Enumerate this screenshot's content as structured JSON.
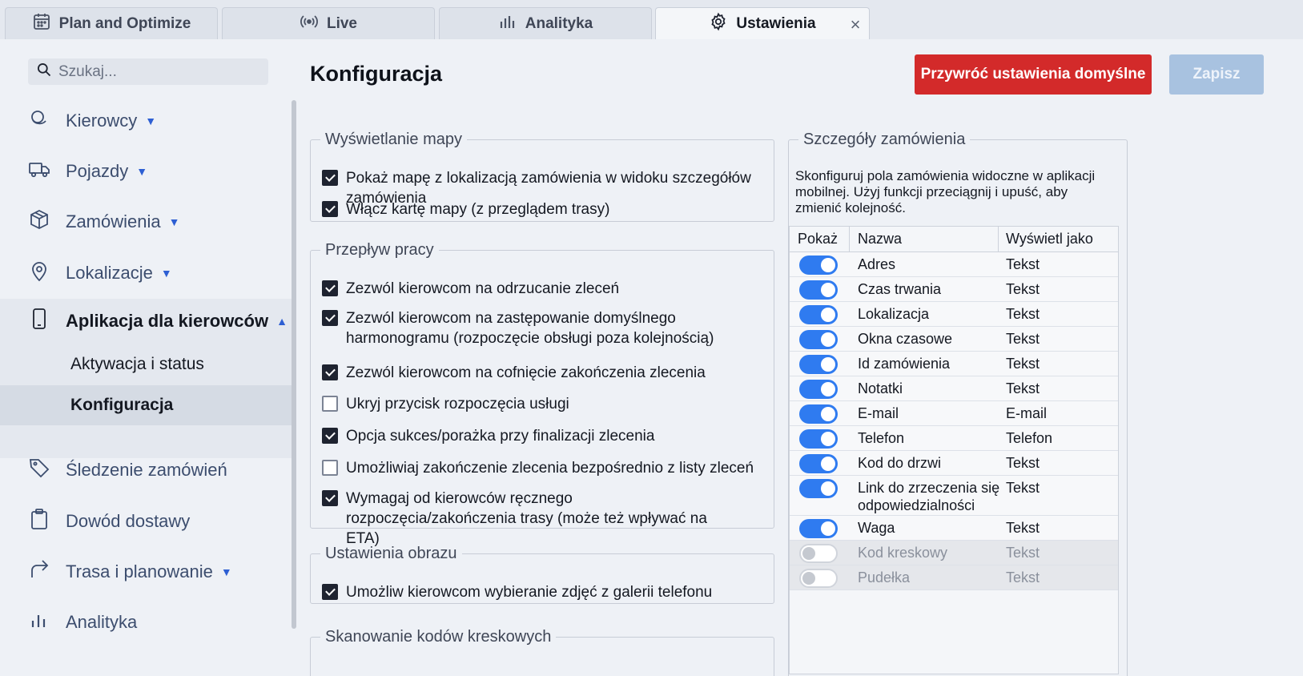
{
  "tabs": [
    {
      "label": "Plan and Optimize",
      "icon": "calendar-icon"
    },
    {
      "label": "Live",
      "icon": "broadcast-icon"
    },
    {
      "label": "Analityka",
      "icon": "bar-chart-icon"
    },
    {
      "label": "Ustawienia",
      "icon": "gear-icon",
      "active": true
    }
  ],
  "tab_close": "×",
  "search": {
    "placeholder": "Szukaj..."
  },
  "sidebar": {
    "items": [
      {
        "label": "Kierowcy",
        "icon": "drivers-icon",
        "caret": "▼"
      },
      {
        "label": "Pojazdy",
        "icon": "truck-icon",
        "caret": "▼"
      },
      {
        "label": "Zamówienia",
        "icon": "box-icon",
        "caret": "▼"
      },
      {
        "label": "Lokalizacje",
        "icon": "map-pin-icon",
        "caret": "▼"
      },
      {
        "label": "Aplikacja dla kierowców",
        "icon": "phone-icon",
        "caret": "▲"
      },
      {
        "label": "Śledzenie zamówień",
        "icon": "tag-icon"
      },
      {
        "label": "Dowód dostawy",
        "icon": "clipboard-icon"
      },
      {
        "label": "Trasa i planowanie",
        "icon": "route-arrow-icon",
        "caret": "▼"
      },
      {
        "label": "Analityka",
        "icon": "bar-chart-icon"
      }
    ],
    "sub_items": [
      {
        "label": "Aktywacja i status"
      },
      {
        "label": "Konfiguracja",
        "selected": true
      }
    ]
  },
  "main": {
    "title": "Konfiguracja",
    "reset_label": "Przywróć ustawienia domyślne",
    "save_label": "Zapisz"
  },
  "groups": {
    "map": {
      "legend": "Wyświetlanie mapy",
      "options": [
        {
          "label": "Pokaż mapę z lokalizacją zamówienia w widoku szczegółów zamówienia",
          "checked": true
        },
        {
          "label": "Włącz kartę mapy (z przeglądem trasy)",
          "checked": true
        }
      ]
    },
    "workflow": {
      "legend": "Przepływ pracy",
      "options": [
        {
          "label": "Zezwól kierowcom na odrzucanie zleceń",
          "checked": true
        },
        {
          "label": "Zezwól kierowcom na zastępowanie domyślnego harmonogramu (rozpoczęcie obsługi poza kolejnością)",
          "checked": true
        },
        {
          "label": "Zezwól kierowcom na cofnięcie zakończenia zlecenia",
          "checked": true
        },
        {
          "label": "Ukryj przycisk rozpoczęcia usługi",
          "checked": false
        },
        {
          "label": "Opcja sukces/porażka przy finalizacji zlecenia",
          "checked": true
        },
        {
          "label": "Umożliwiaj zakończenie zlecenia bezpośrednio z listy zleceń",
          "checked": false
        },
        {
          "label": "Wymagaj od kierowców ręcznego rozpoczęcia/zakończenia trasy (może też wpływać na ETA)",
          "checked": true
        }
      ]
    },
    "image": {
      "legend": "Ustawienia obrazu",
      "options": [
        {
          "label": "Umożliw kierowcom wybieranie zdjęć z galerii telefonu",
          "checked": true
        }
      ]
    },
    "barcode": {
      "legend": "Skanowanie kodów kreskowych"
    }
  },
  "order_details": {
    "legend": "Szczegóły zamówienia",
    "description": "Skonfiguruj pola zamówienia widoczne w aplikacji mobilnej. Użyj funkcji przeciągnij i upuść, aby zmienić kolejność.",
    "columns": [
      "Pokaż",
      "Nazwa",
      "Wyświetl jako"
    ],
    "rows": [
      {
        "show": true,
        "name": "Adres",
        "display": "Tekst"
      },
      {
        "show": true,
        "name": "Czas trwania",
        "display": "Tekst"
      },
      {
        "show": true,
        "name": "Lokalizacja",
        "display": "Tekst"
      },
      {
        "show": true,
        "name": "Okna czasowe",
        "display": "Tekst"
      },
      {
        "show": true,
        "name": "Id zamówienia",
        "display": "Tekst"
      },
      {
        "show": true,
        "name": "Notatki",
        "display": "Tekst"
      },
      {
        "show": true,
        "name": "E-mail",
        "display": "E-mail"
      },
      {
        "show": true,
        "name": "Telefon",
        "display": "Telefon"
      },
      {
        "show": true,
        "name": "Kod do drzwi",
        "display": "Tekst"
      },
      {
        "show": true,
        "name": "Link do zrzeczenia się odpowiedzialności",
        "display": "Tekst"
      },
      {
        "show": true,
        "name": "Waga",
        "display": "Tekst"
      },
      {
        "show": false,
        "name": "Kod kreskowy",
        "display": "Tekst"
      },
      {
        "show": false,
        "name": "Pudełka",
        "display": "Tekst"
      }
    ]
  }
}
